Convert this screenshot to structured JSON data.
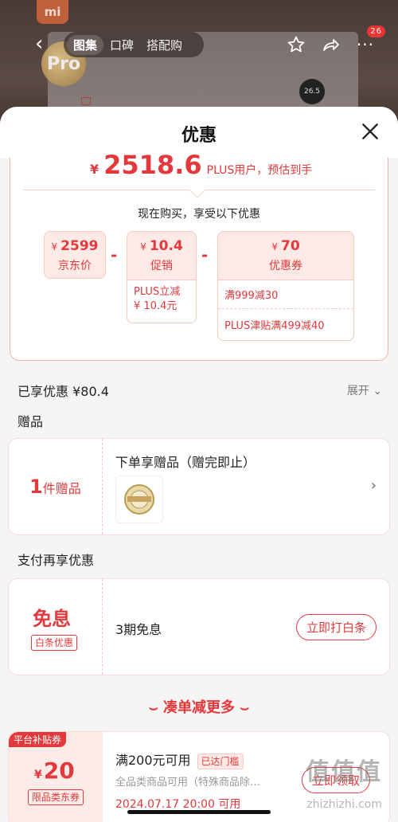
{
  "background": {
    "logo": "mi",
    "medal": "Pro",
    "device_display": "26.5",
    "tabs": [
      {
        "label": "图集",
        "active": true
      },
      {
        "label": "口碑",
        "active": false
      },
      {
        "label": "搭配购",
        "active": false
      }
    ],
    "more_badge": "26",
    "icons": [
      "star-icon",
      "share-icon",
      "more-icon"
    ]
  },
  "sheet": {
    "title": "优惠",
    "estimate": {
      "currency": "¥",
      "amount": "2518.6",
      "note": "PLUS用户，预估到手"
    },
    "calc_title": "现在购买，享受以下优惠",
    "jd_price": {
      "currency": "¥",
      "value": "2599",
      "label": "京东价"
    },
    "promo": {
      "currency": "¥",
      "value": "10.4",
      "label": "促销",
      "detail": "PLUS立减\n¥ 10.4元"
    },
    "coupon_total": {
      "currency": "¥",
      "value": "70",
      "label": "优惠券",
      "items": [
        "满999减30",
        "PLUS津贴满499减40"
      ]
    },
    "minus": "-",
    "enjoyed": "已享优惠 ¥80.4",
    "expand": "展开",
    "gift": {
      "section_title": "赠品",
      "count": "1",
      "count_suffix": "件赠品",
      "title": "下单享赠品（赠完即止）"
    },
    "pay": {
      "section_title": "支付再享优惠",
      "big": "免息",
      "tag": "白条优惠",
      "text": "3期免息",
      "button": "立即打白条"
    },
    "more_title": "凑单减更多",
    "platform_coupon": {
      "corner": "平台补贴券",
      "currency": "¥",
      "value": "20",
      "tag": "限品类东券",
      "title": "满200元可用",
      "reached": "已达门槛",
      "desc": "全品类商品可用（特殊商品除…",
      "time": "2024.07.17 20:00 可用",
      "button": "立即领取"
    },
    "watermark": "值值值",
    "watermark_url": "zhizhizhi.com"
  },
  "colors": {
    "accent": "#e4393c",
    "accent_light": "#fde9e6"
  }
}
